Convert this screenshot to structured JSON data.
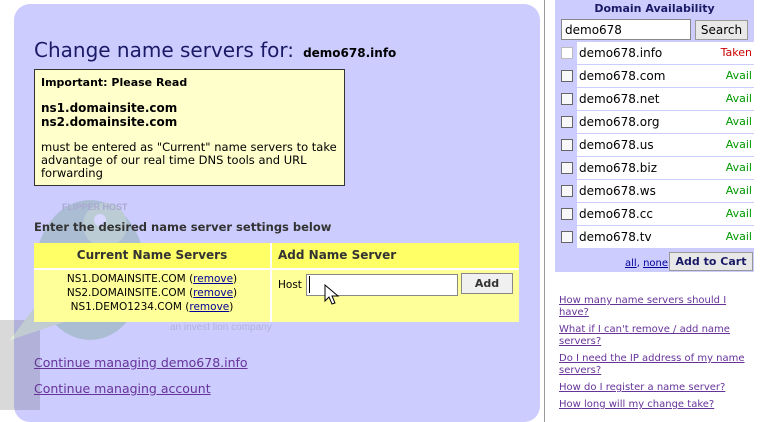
{
  "heading": {
    "text": "Change name servers for:",
    "domain": "demo678.info"
  },
  "notice": {
    "title": "Important: Please Read",
    "ns1": "ns1.domainsite.com",
    "ns2": "ns2.domainsite.com",
    "body": "must be entered as \"Current\" name servers to take advantage of our real time DNS tools and URL forwarding"
  },
  "settings_heading": "Enter the desired name server settings below",
  "table": {
    "col_current": "Current Name Servers",
    "col_add": "Add Name Server",
    "servers": [
      {
        "name": "NS1.DOMAINSITE.COM",
        "remove": "remove"
      },
      {
        "name": "NS2.DOMAINSITE.COM",
        "remove": "remove"
      },
      {
        "name": "NS1.DEMO1234.COM",
        "remove": "remove"
      }
    ],
    "host_label": "Host :",
    "host_value": "",
    "add_label": "Add"
  },
  "links": {
    "continue_domain": "Continue managing demo678.info",
    "continue_account": "Continue managing account"
  },
  "watermark": {
    "brand": "FlipperHost",
    "tagline": "an invest lion company",
    "badge": "FLIPPER HOST"
  },
  "sidebar": {
    "title": "Domain Availability",
    "search_value": "demo678",
    "search_label": "Search",
    "domains": [
      {
        "name": "demo678.info",
        "status": "Taken",
        "state": "taken"
      },
      {
        "name": "demo678.com",
        "status": "Avail",
        "state": "avail"
      },
      {
        "name": "demo678.net",
        "status": "Avail",
        "state": "avail"
      },
      {
        "name": "demo678.org",
        "status": "Avail",
        "state": "avail"
      },
      {
        "name": "demo678.us",
        "status": "Avail",
        "state": "avail"
      },
      {
        "name": "demo678.biz",
        "status": "Avail",
        "state": "avail"
      },
      {
        "name": "demo678.ws",
        "status": "Avail",
        "state": "avail"
      },
      {
        "name": "demo678.cc",
        "status": "Avail",
        "state": "avail"
      },
      {
        "name": "demo678.tv",
        "status": "Avail",
        "state": "avail"
      }
    ],
    "select_all": "all",
    "select_none": "none",
    "separator": ",",
    "cart_label": "Add to Cart"
  },
  "faq": [
    "How many name servers should I have?",
    "What if I can't remove / add name servers?",
    "Do I need the IP address of my name servers?",
    "How do I register a name server?",
    "How long will my change take?"
  ],
  "colors": {
    "panel": "#ccccff",
    "notice": "#ffffcc",
    "table": "#ffff99",
    "avail": "#009900",
    "taken": "#cc0000",
    "link": "#663399"
  }
}
